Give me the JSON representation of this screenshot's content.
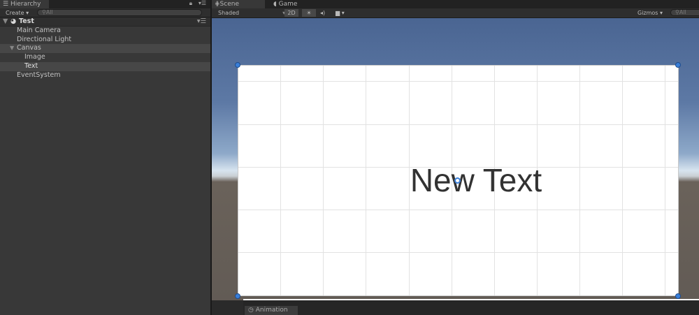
{
  "hierarchy": {
    "tab": "Hierarchy",
    "create": "Create",
    "search_placeholder": "All",
    "scene_name": "Test",
    "items": [
      {
        "label": "Main Camera"
      },
      {
        "label": "Directional Light"
      },
      {
        "label": "Canvas"
      },
      {
        "label": "Image"
      },
      {
        "label": "Text"
      },
      {
        "label": "EventSystem"
      }
    ]
  },
  "scene": {
    "tabs": [
      "Scene",
      "Game"
    ],
    "shading": "Shaded",
    "mode_2d": "2D",
    "gizmos": "Gizmos",
    "search_placeholder": "All",
    "ui_text": "New Text"
  },
  "bottom": {
    "tab": "Animation"
  },
  "colors": {
    "handle": "#3a7fd8",
    "selected_row": "#474747"
  }
}
